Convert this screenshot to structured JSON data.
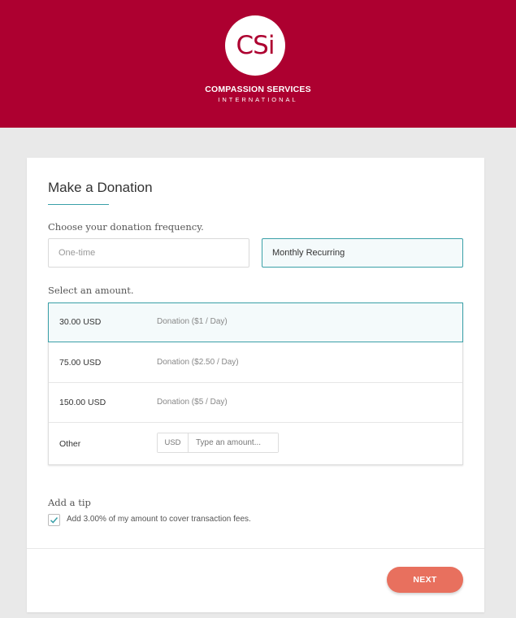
{
  "header": {
    "logo_text": "CSi",
    "org_name": "COMPASSION SERVICES",
    "org_sub": "INTERNATIONAL"
  },
  "form": {
    "title": "Make a Donation",
    "frequency_label": "Choose your donation frequency.",
    "frequency_options": [
      "One-time",
      "Monthly Recurring"
    ],
    "frequency_selected": "Monthly Recurring",
    "amount_label": "Select an amount.",
    "amounts": [
      {
        "amount": "30.00 USD",
        "desc": "Donation ($1 / Day)",
        "selected": true
      },
      {
        "amount": "75.00 USD",
        "desc": "Donation ($2.50 / Day)",
        "selected": false
      },
      {
        "amount": "150.00 USD",
        "desc": "Donation ($5 / Day)",
        "selected": false
      }
    ],
    "other": {
      "label": "Other",
      "currency": "USD",
      "placeholder": "Type an amount..."
    },
    "tip": {
      "label": "Add a tip",
      "checkbox_text": "Add 3.00% of my amount to cover transaction fees.",
      "checked": true
    },
    "next_label": "NEXT"
  },
  "colors": {
    "brand": "#ad0030",
    "accent": "#3aa0a8",
    "button": "#e8705e"
  }
}
